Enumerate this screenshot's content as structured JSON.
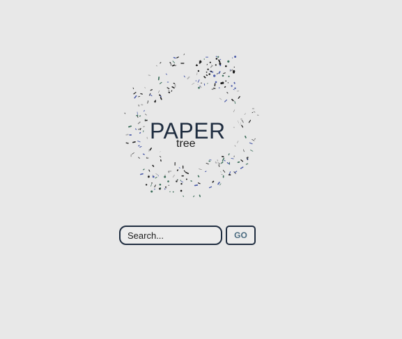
{
  "logo": {
    "title": "PAPER",
    "subtitle": "tree"
  },
  "search": {
    "placeholder": "Search...",
    "button_label": "GO"
  },
  "colors": {
    "background": "#e8e8e8",
    "primary": "#1f2d40",
    "button_text": "#4a6b80",
    "dot_dark": "#1c1c1c",
    "dot_blue": "#4a5aa8",
    "dot_green": "#3c6e5a"
  }
}
